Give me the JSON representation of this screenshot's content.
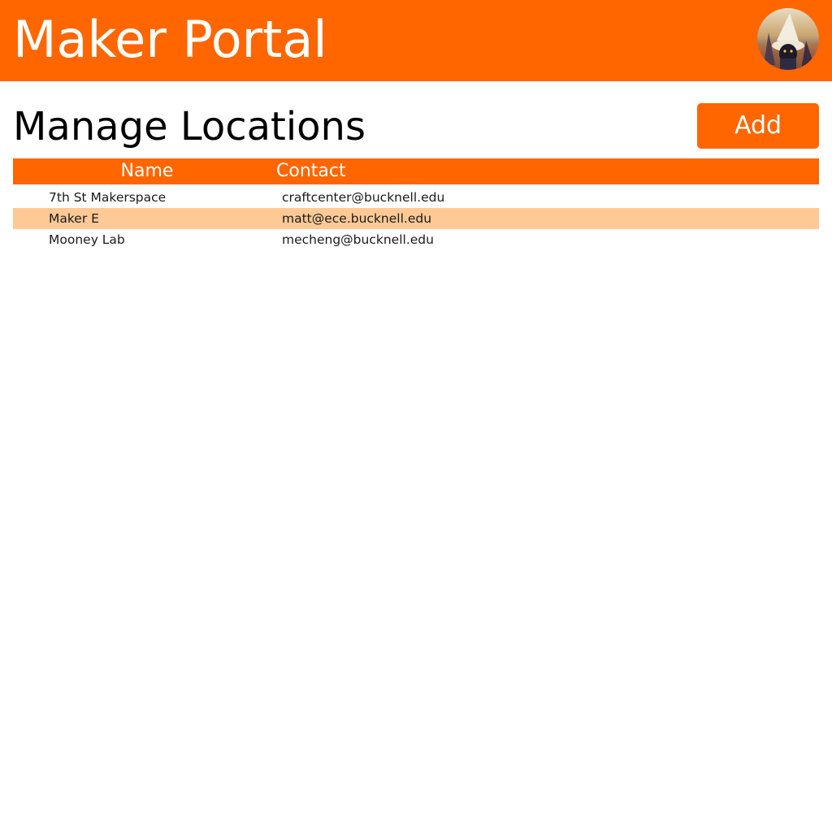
{
  "header": {
    "app_title": "Maker Portal",
    "avatar_icon": "user-avatar-icon"
  },
  "page": {
    "title": "Manage Locations",
    "add_label": "Add"
  },
  "table": {
    "columns": [
      "Name",
      "Contact"
    ],
    "rows": [
      {
        "name": "7th St Makerspace",
        "contact": "craftcenter@bucknell.edu"
      },
      {
        "name": "Maker E",
        "contact": "matt@ece.bucknell.edu"
      },
      {
        "name": "Mooney Lab",
        "contact": "mecheng@bucknell.edu"
      }
    ]
  },
  "colors": {
    "accent": "#ff6600",
    "row_alt": "#ffc996"
  }
}
